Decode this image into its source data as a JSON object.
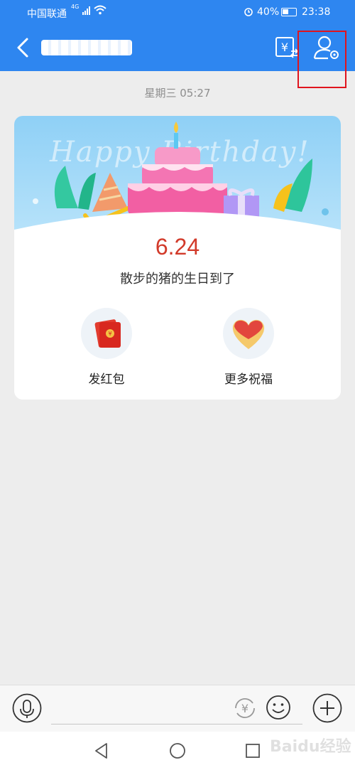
{
  "status_bar": {
    "carrier": "中国联通",
    "network": "4G",
    "battery": "40%",
    "time": "23:38"
  },
  "nav": {
    "back_icon": "chevron-left-icon",
    "transfer_icon": "yen-transfer-icon",
    "settings_icon": "person-settings-icon"
  },
  "chat": {
    "timestamp": "星期三 05:27"
  },
  "birthday_card": {
    "banner_text": "Happy Birthday!",
    "date": "6.24",
    "message": "散步的猪的生日到了",
    "actions": [
      {
        "label": "发红包",
        "icon": "red-envelope-icon"
      },
      {
        "label": "更多祝福",
        "icon": "heart-icon"
      }
    ]
  },
  "input_bar": {
    "voice_icon": "microphone-icon",
    "red_packet_icon": "yen-circle-icon",
    "emoji_icon": "smiley-icon",
    "plus_icon": "plus-icon"
  },
  "watermark": "Baidu经验",
  "colors": {
    "brand_blue": "#2e86f0",
    "date_red": "#d23a2a",
    "highlight": "#e0141e"
  }
}
